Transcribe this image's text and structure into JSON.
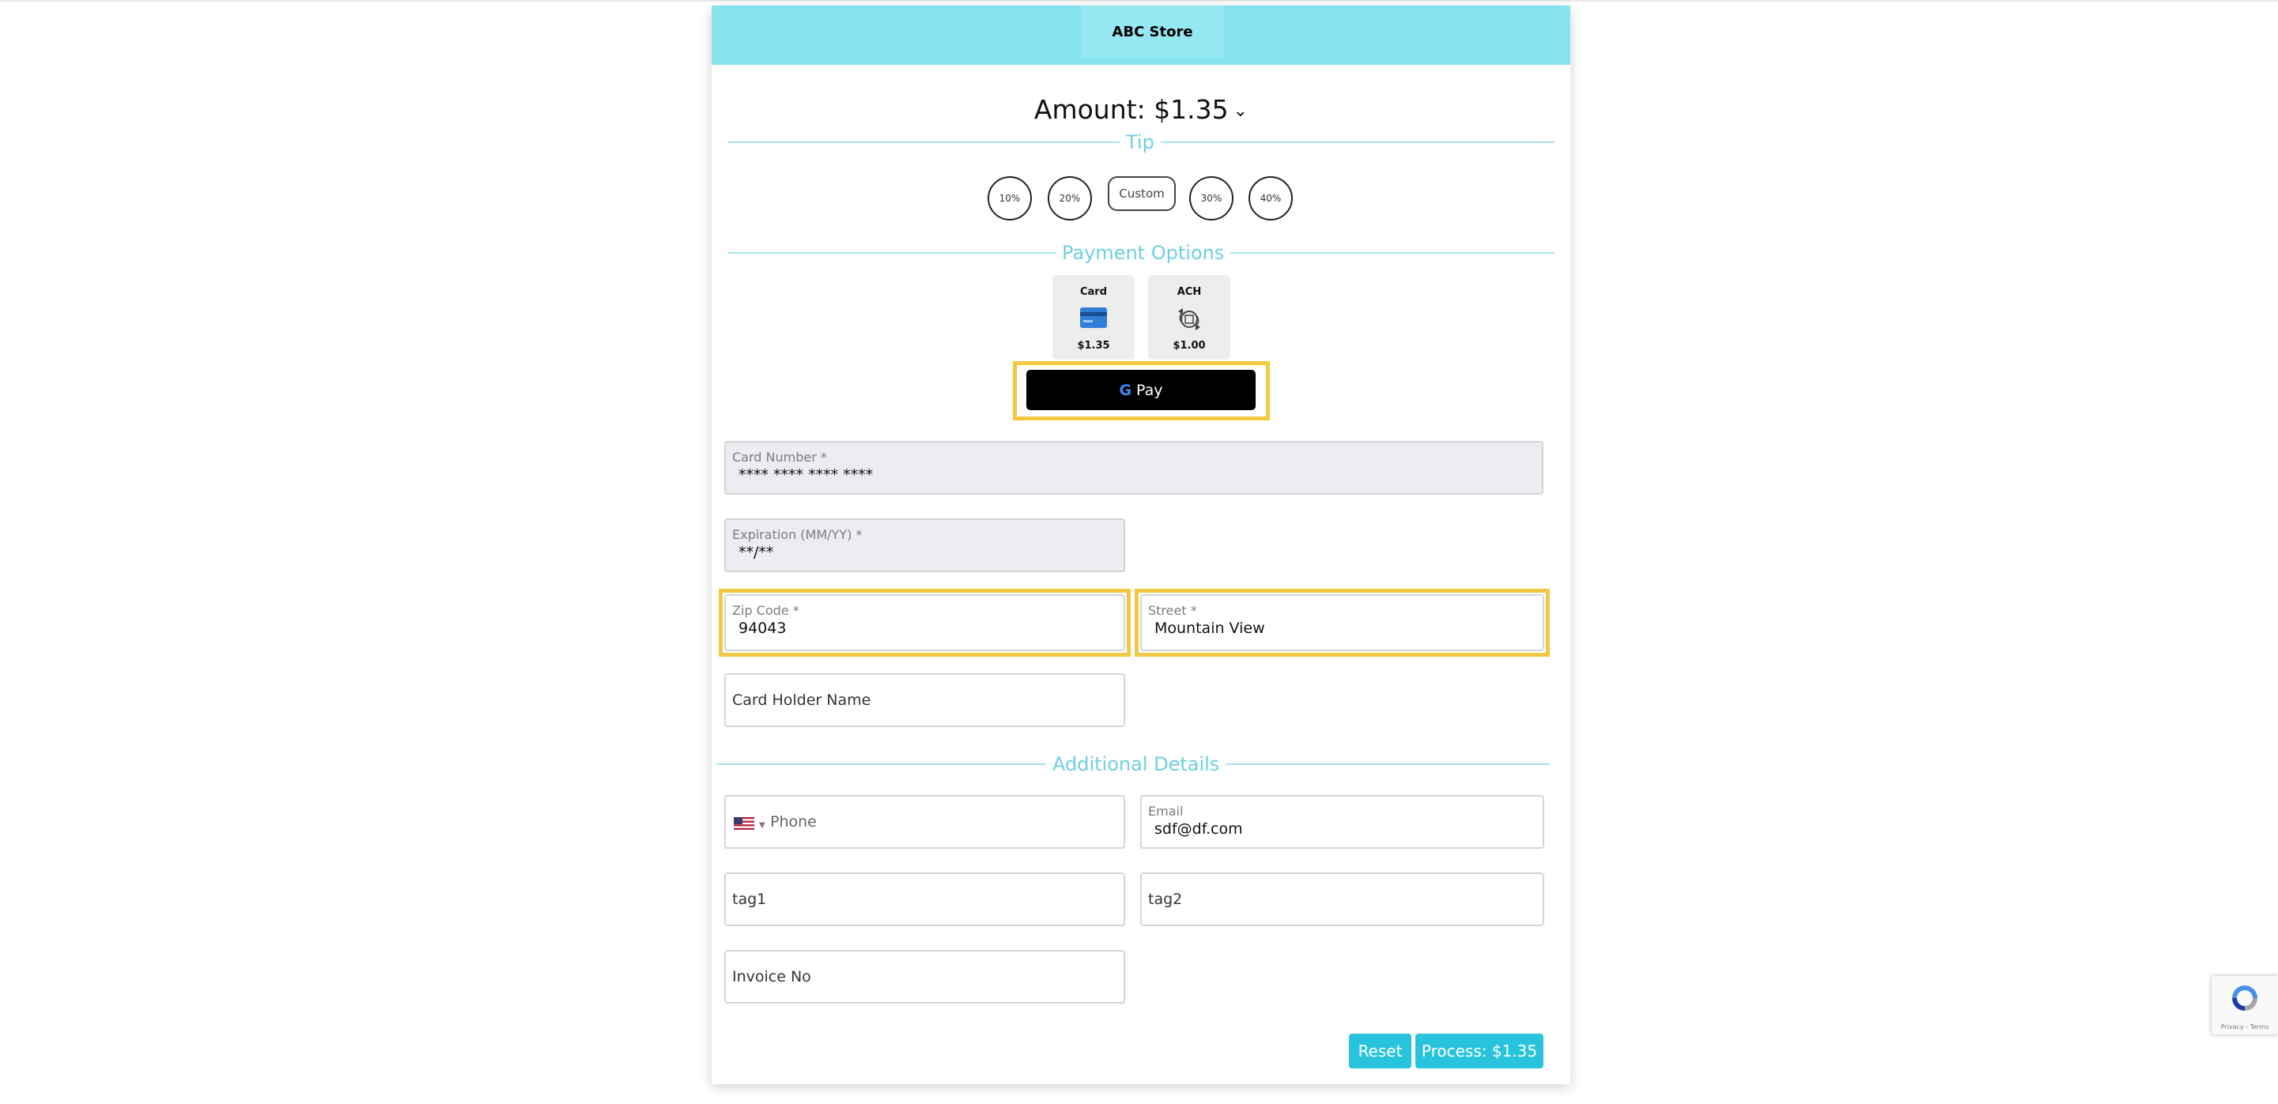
{
  "store": {
    "name": "ABC Store"
  },
  "amount": {
    "label": "Amount: $1.35"
  },
  "sections": {
    "tip": "Tip",
    "payment_options": "Payment Options",
    "additional_details": "Additional Details"
  },
  "tips": [
    {
      "label": "10%"
    },
    {
      "label": "20%"
    },
    {
      "label": "Custom"
    },
    {
      "label": "30%"
    },
    {
      "label": "40%"
    }
  ],
  "payment_options": [
    {
      "name": "Card",
      "price": "$1.35",
      "icon": "credit-card-icon",
      "color": "#2f7fd6"
    },
    {
      "name": "ACH",
      "price": "$1.00",
      "icon": "bank-transfer-icon"
    }
  ],
  "gpay": {
    "label": "Pay",
    "g": "G"
  },
  "form": {
    "card_number": {
      "label": "Card Number *",
      "value": "**** **** **** ****"
    },
    "expiration": {
      "label": "Expiration (MM/YY) *",
      "value": "**/**"
    },
    "zip": {
      "label": "Zip Code *",
      "value": "94043"
    },
    "street": {
      "label": "Street *",
      "value": "Mountain View"
    },
    "card_holder": {
      "placeholder": "Card Holder Name"
    },
    "phone": {
      "placeholder": "Phone",
      "country": "US"
    },
    "email": {
      "label": "Email",
      "value": "sdf@df.com"
    },
    "tag1": {
      "placeholder": "tag1"
    },
    "tag2": {
      "placeholder": "tag2"
    },
    "invoice": {
      "placeholder": "Invoice No"
    }
  },
  "buttons": {
    "reset": "Reset",
    "process": "Process: $1.35"
  },
  "recaptcha": {
    "text": "Privacy - Terms"
  },
  "colors": {
    "header": "#87e3ef",
    "accent": "#28c3dc",
    "highlight": "#f4c842",
    "section_line": "#a8e4ec"
  }
}
